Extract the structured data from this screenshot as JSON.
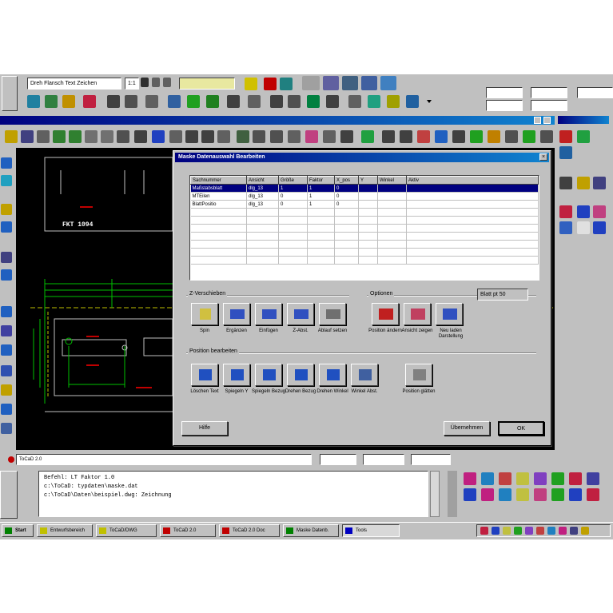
{
  "top_toolbar": {
    "style_combo": "Dreh Flansch Text Zeichen",
    "scale_combo": "1:1"
  },
  "dialog": {
    "title": "Maske Datenauswahl Bearbeiten",
    "table": {
      "headers": [
        "Sachnummer",
        "Ansicht",
        "Größe",
        "Faktor",
        "X_pos",
        "Y",
        "Winkel",
        "Aktiv"
      ],
      "rows": [
        [
          "Maßstabsblatt",
          "dlg_13",
          "1",
          "1",
          "0",
          "",
          "",
          ""
        ],
        [
          "MTEilen",
          "dlg_13",
          "0",
          "1",
          "0",
          "",
          "",
          ""
        ],
        [
          "BlattPositio",
          "dlg_13",
          "0",
          "1",
          "0",
          "",
          "",
          ""
        ]
      ]
    },
    "group1": {
      "label": "Z-Verschieben",
      "tools": [
        "Spin",
        "Ergänzen",
        "Einfügen",
        "Z-Abst.",
        "Ablauf setzen"
      ]
    },
    "group2": {
      "label": "Optionen",
      "tools": [
        "Position ändern",
        "Ansicht zeigen",
        "Neu laden Darstellung"
      ],
      "combo": "Blatt pt 50"
    },
    "group3": {
      "label": "Position bearbeiten",
      "tools": [
        "Löschen Text",
        "Spiegeln Y",
        "Spiegeln Bezug",
        "Drehen Bezug",
        "Drehen Winkel",
        "Winkel Abst.",
        "Position glätten"
      ]
    },
    "buttons": {
      "help": "Hilfe",
      "apply": "Übernehmen",
      "ok": "OK"
    }
  },
  "canvas": {
    "label": "FKT 1094"
  },
  "status_bar": {
    "field1": "ToCaD 2.0"
  },
  "command_window": {
    "lines": [
      "Befehl: LT Faktor 1.0",
      "c:\\ToCaD: typdaten\\maske.dat",
      "c:\\ToCaD\\Daten\\beispiel.dwg: Zeichnung"
    ]
  },
  "taskbar": {
    "start": "Start",
    "items": [
      "Entwurfsbereich",
      "ToCaD/DWG",
      "ToCaD 2.0",
      "ToCaD 2.0 Doc",
      "Maske Datenb.",
      "Tools"
    ],
    "colors": {
      "start": "#008000",
      "item_icons": [
        "#c0c000",
        "#c0c000",
        "#c00000",
        "#c00000",
        "#008000",
        "#0000c0"
      ]
    }
  },
  "colors": {
    "desktop": "#c0c0c0",
    "canvas_bg": "#000000",
    "cad_green": "#00c000",
    "cad_yellow": "#c0c000",
    "cad_red": "#c00000",
    "selection": "#000080"
  }
}
